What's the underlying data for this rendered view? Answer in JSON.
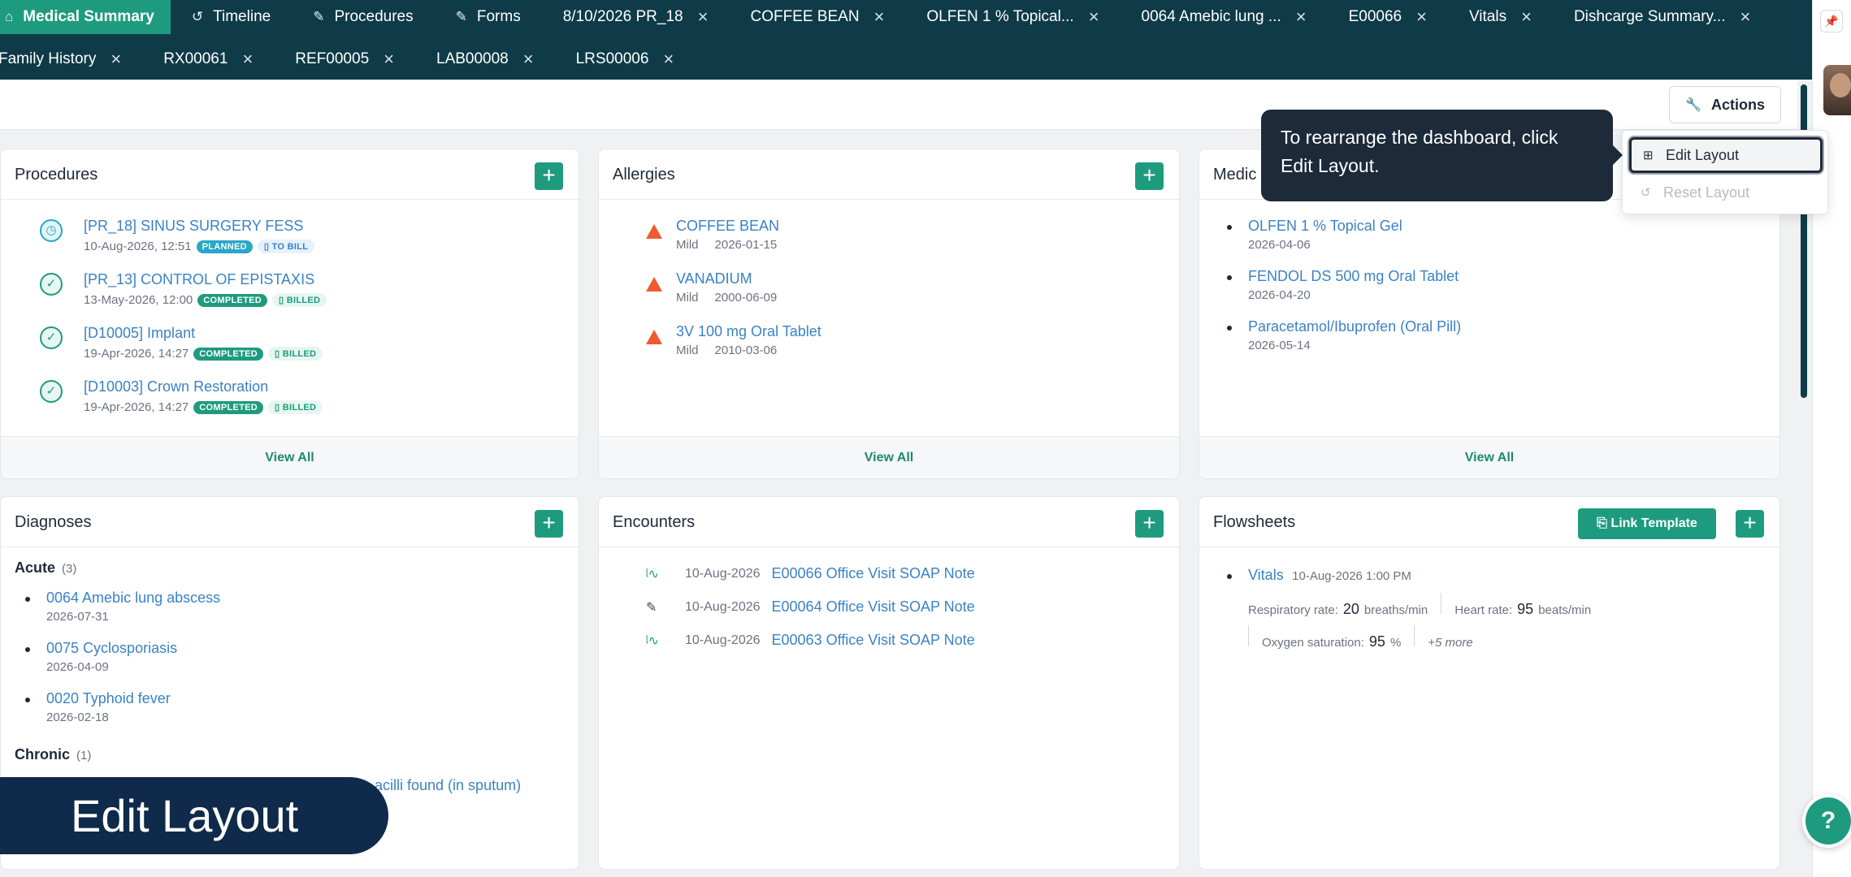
{
  "tabs_row1": [
    {
      "label": "Medical Summary",
      "icon": "home-icon",
      "active": true,
      "closable": false
    },
    {
      "label": "Timeline",
      "icon": "history-icon",
      "closable": false
    },
    {
      "label": "Procedures",
      "icon": "pencil-icon",
      "closable": false
    },
    {
      "label": "Forms",
      "icon": "pencil-icon",
      "closable": false
    },
    {
      "label": "8/10/2026 PR_18",
      "closable": true
    },
    {
      "label": "COFFEE BEAN",
      "closable": true
    },
    {
      "label": "OLFEN 1 % Topical...",
      "closable": true
    },
    {
      "label": "0064 Amebic lung ...",
      "closable": true
    },
    {
      "label": "E00066",
      "closable": true
    },
    {
      "label": "Vitals",
      "closable": true
    },
    {
      "label": "Dishcarge Summary...",
      "closable": true
    }
  ],
  "tabs_row2": [
    {
      "label": "Family History",
      "closable": true
    },
    {
      "label": "RX00061",
      "closable": true
    },
    {
      "label": "REF00005",
      "closable": true
    },
    {
      "label": "LAB00008",
      "closable": true
    },
    {
      "label": "LRS00006",
      "closable": true
    }
  ],
  "actions": {
    "label": "Actions"
  },
  "actions_menu": {
    "edit_layout": "Edit Layout",
    "reset_layout": "Reset Layout"
  },
  "tooltip": {
    "text": "To rearrange the dashboard, click Edit Layout."
  },
  "caption": {
    "text": "Edit Layout"
  },
  "help": {
    "label": "?"
  },
  "view_all": "View All",
  "procedures": {
    "title": "Procedures",
    "items": [
      {
        "title": "[PR_18] SINUS SURGERY FESS",
        "datetime": "10-Aug-2026, 12:51",
        "status": "PLANNED",
        "billing": "TO BILL"
      },
      {
        "title": "[PR_13] CONTROL OF EPISTAXIS",
        "datetime": "13-May-2026, 12:00",
        "status": "COMPLETED",
        "billing": "BILLED"
      },
      {
        "title": "[D10005] Implant",
        "datetime": "19-Apr-2026, 14:27",
        "status": "COMPLETED",
        "billing": "BILLED"
      },
      {
        "title": "[D10003] Crown Restoration",
        "datetime": "19-Apr-2026, 14:27",
        "status": "COMPLETED",
        "billing": "BILLED"
      }
    ]
  },
  "allergies": {
    "title": "Allergies",
    "items": [
      {
        "name": "COFFEE BEAN",
        "severity": "Mild",
        "date": "2026-01-15"
      },
      {
        "name": "VANADIUM",
        "severity": "Mild",
        "date": "2000-06-09"
      },
      {
        "name": "3V 100 mg Oral Tablet",
        "severity": "Mild",
        "date": "2010-03-06"
      }
    ]
  },
  "medications": {
    "title": "Medic",
    "items": [
      {
        "name": "OLFEN 1 % Topical Gel",
        "date": "2026-04-06"
      },
      {
        "name": "FENDOL DS 500 mg Oral Tablet",
        "date": "2026-04-20"
      },
      {
        "name": "Paracetamol/Ibuprofen (Oral Pill)",
        "date": "2026-05-14"
      }
    ]
  },
  "diagnoses": {
    "title": "Diagnoses",
    "acute_label": "Acute",
    "acute_count": "(3)",
    "acute": [
      {
        "name": "0064 Amebic lung abscess",
        "date": "2026-07-31"
      },
      {
        "name": "0075 Cyclosporiasis",
        "date": "2026-04-09"
      },
      {
        "name": "0020 Typhoid fever",
        "date": "2026-02-18"
      }
    ],
    "chronic_label": "Chronic",
    "chronic_count": "(1)",
    "chronic_partial": "acilli found (in sputum)"
  },
  "encounters": {
    "title": "Encounters",
    "items": [
      {
        "date": "10-Aug-2026",
        "title": "E00066 Office Visit SOAP Note",
        "icon": "signature-icon"
      },
      {
        "date": "10-Aug-2026",
        "title": "E00064 Office Visit SOAP Note",
        "icon": "pencil-icon"
      },
      {
        "date": "10-Aug-2026",
        "title": "E00063 Office Visit SOAP Note",
        "icon": "signature-icon"
      }
    ]
  },
  "flowsheets": {
    "title": "Flowsheets",
    "link_template": "Link Template",
    "entry": {
      "name": "Vitals",
      "datetime": "10-Aug-2026 1:00 PM",
      "respiratory_label": "Respiratory rate:",
      "respiratory_value": "20",
      "respiratory_unit": "breaths/min",
      "heart_label": "Heart rate:",
      "heart_value": "95",
      "heart_unit": "beats/min",
      "oxygen_label": "Oxygen saturation:",
      "oxygen_value": "95",
      "oxygen_unit": "%",
      "more": "+5 more"
    }
  },
  "colors": {
    "header": "#0f3b48",
    "accent": "#1e9b7f",
    "link": "#3b82c4",
    "alert": "#f05a30",
    "tooltip": "#1c2a3a"
  }
}
